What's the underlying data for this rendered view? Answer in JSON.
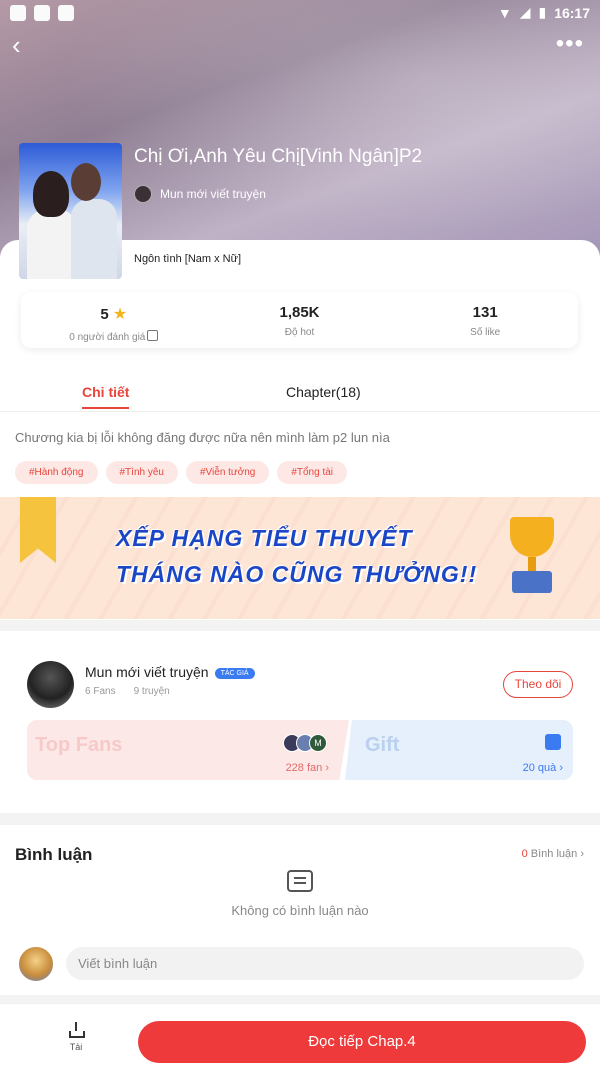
{
  "status_bar": {
    "time": "16:17"
  },
  "book": {
    "title": "Chị Ơi,Anh Yêu Chị[Vinh Ngân]P2",
    "author": "Mun mới viết truyện",
    "genre": "Ngôn tình [Nam x Nữ]"
  },
  "stats": [
    {
      "value": "5",
      "label": "0 người đánh giá"
    },
    {
      "value": "1,85K",
      "label": "Độ hot"
    },
    {
      "value": "131",
      "label": "Số like"
    }
  ],
  "tabs": {
    "detail": "Chi tiết",
    "chapter": "Chapter(18)"
  },
  "description": "Chương kia bị lỗi không đăng được nữa nên mình làm p2 lun nìa",
  "tags": [
    "#Hành động",
    "#Tình yêu",
    "#Viễn tưởng",
    "#Tổng tài"
  ],
  "banner": {
    "line1": "XẾP HẠNG TIỂU THUYẾT",
    "line2": "THÁNG NÀO CŨNG THƯỞNG!!"
  },
  "author_card": {
    "name": "Mun mới viết truyện",
    "badge": "TÁC GIẢ",
    "fans": "6 Fans",
    "stories": "9 truyện",
    "follow_label": "Theo dõi",
    "top_fans_title": "Top Fans",
    "top_fans_count": "228 fan",
    "gift_title": "Gift",
    "gift_count": "20 quà",
    "fan_avatar_letter": "M"
  },
  "comments": {
    "title": "Bình luận",
    "count": "0",
    "count_label": "Bình luận",
    "empty_text": "Không có bình luận nào",
    "input_placeholder": "Viết bình luận"
  },
  "bottom": {
    "download_label": "Tải",
    "read_label": "Đọc tiếp Chap.4"
  },
  "colors": {
    "accent": "#e8453c",
    "blue": "#3a7bf2",
    "star": "#f3b41a"
  },
  "icons": [
    "back-arrow-icon",
    "more-dots-icon",
    "star-icon",
    "edit-icon",
    "gift-icon",
    "chat-empty-icon",
    "download-icon"
  ]
}
